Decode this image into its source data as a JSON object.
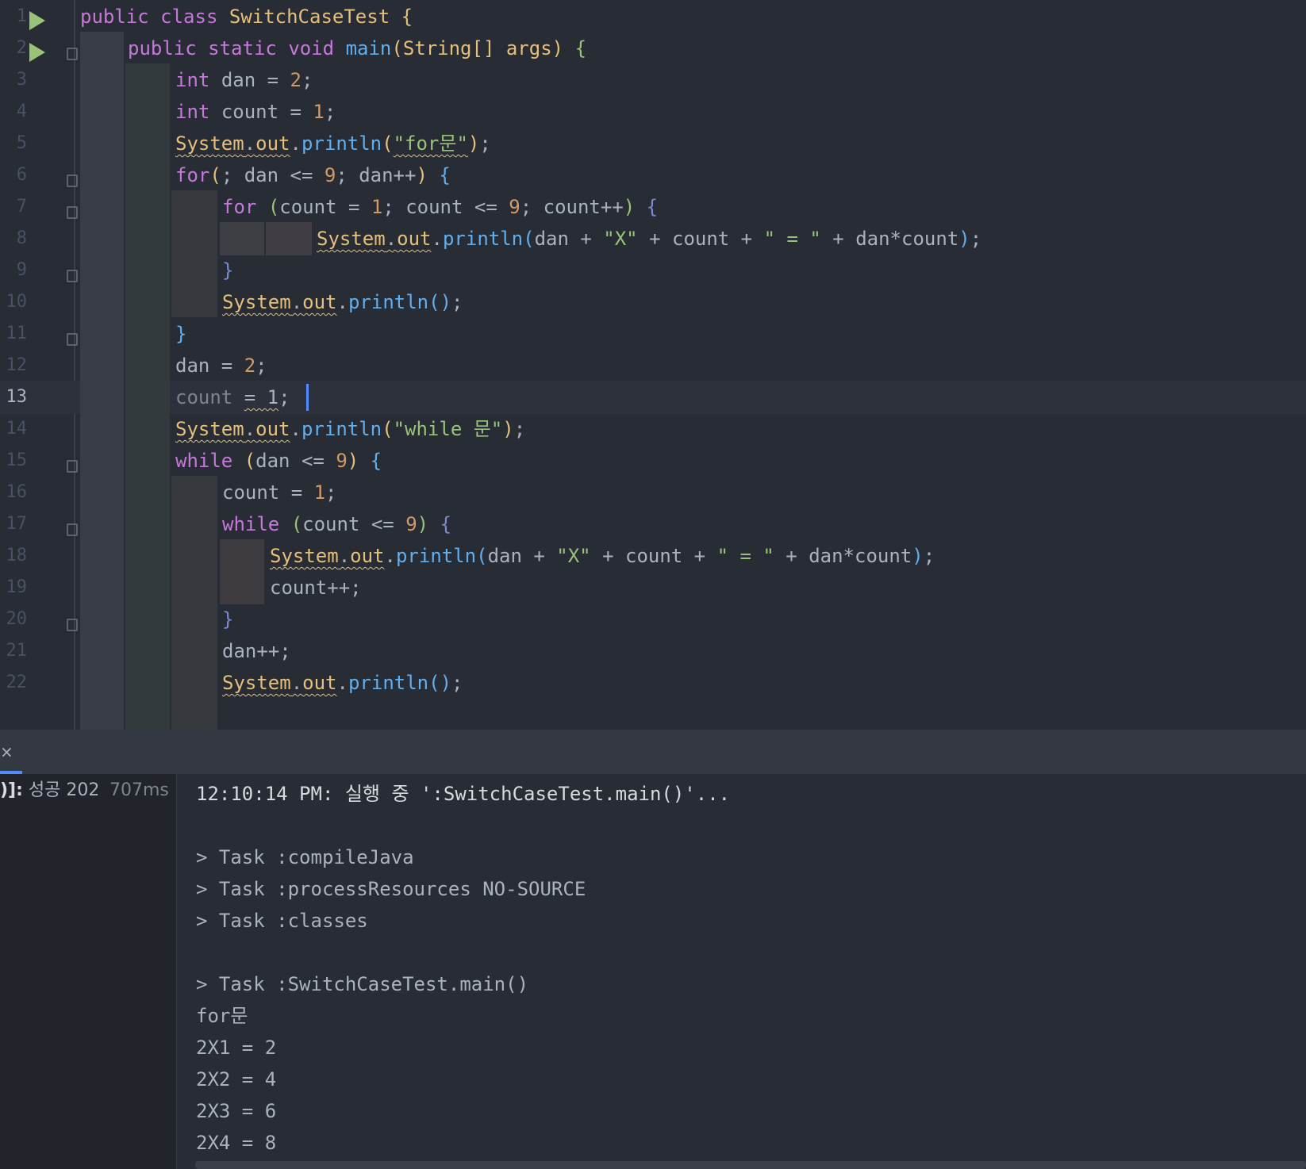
{
  "editor": {
    "current_line": 13,
    "lines": [
      {
        "n": "1"
      },
      {
        "n": "2"
      },
      {
        "n": "3"
      },
      {
        "n": "4"
      },
      {
        "n": "5"
      },
      {
        "n": "6"
      },
      {
        "n": "7"
      },
      {
        "n": "8"
      },
      {
        "n": "9"
      },
      {
        "n": "10"
      },
      {
        "n": "11"
      },
      {
        "n": "12"
      },
      {
        "n": "13"
      },
      {
        "n": "14"
      },
      {
        "n": "15"
      },
      {
        "n": "16"
      },
      {
        "n": "17"
      },
      {
        "n": "18"
      },
      {
        "n": "19"
      },
      {
        "n": "20"
      },
      {
        "n": "21"
      },
      {
        "n": "22"
      }
    ],
    "tokens": {
      "l1": [
        "public",
        "class",
        "SwitchCaseTest",
        "{"
      ],
      "l2": [
        "public",
        "static",
        "void",
        "main",
        "(",
        "String[]",
        "args",
        ")",
        "{"
      ],
      "l3": [
        "int",
        "dan",
        "=",
        "2",
        ";"
      ],
      "l4": [
        "int",
        "count",
        "=",
        "1",
        ";"
      ],
      "l5": [
        "System",
        ".",
        "out",
        ".",
        "println",
        "(",
        "\"for문\"",
        ")",
        ";"
      ],
      "l6": [
        "for",
        "(",
        "; dan <= ",
        "9",
        "; dan++",
        ")",
        "{"
      ],
      "l7": [
        "for",
        "(",
        "count = ",
        "1",
        "; count <= ",
        "9",
        "; count++",
        ")",
        "{"
      ],
      "l8": [
        "System",
        ".",
        "out",
        ".",
        "println",
        "(",
        "dan + ",
        "\"X\"",
        " + count + ",
        "\" = \"",
        " + dan*count",
        ")",
        ";"
      ],
      "l9": [
        "}"
      ],
      "l10": [
        "System",
        ".",
        "out",
        ".",
        "println",
        "()",
        ";"
      ],
      "l11": [
        "}"
      ],
      "l12": [
        "dan = ",
        "2",
        ";"
      ],
      "l13": [
        "count",
        " ",
        "= 1",
        ";"
      ],
      "l14": [
        "System",
        ".",
        "out",
        ".",
        "println",
        "(",
        "\"while 문\"",
        ")",
        ";"
      ],
      "l15": [
        "while",
        "(",
        "dan <= ",
        "9",
        ")",
        "{"
      ],
      "l16": [
        "count = ",
        "1",
        ";"
      ],
      "l17": [
        "while",
        "(",
        "count <= ",
        "9",
        ")",
        "{"
      ],
      "l18": [
        "System",
        ".",
        "out",
        ".",
        "println",
        "(",
        "dan + ",
        "\"X\"",
        " + count + ",
        "\" = \"",
        " + dan*count",
        ")",
        ";"
      ],
      "l19": [
        "count++;"
      ],
      "l20": [
        "}"
      ],
      "l21": [
        "dan++;"
      ],
      "l22": [
        "System",
        ".",
        "out",
        ".",
        "println",
        "()",
        ";"
      ]
    }
  },
  "build": {
    "status_prefix": ")]:",
    "status_text": "성공 202",
    "time": "707ms"
  },
  "console": {
    "lines": [
      "12:10:14 PM: 실행 중 ':SwitchCaseTest.main()'...",
      "",
      "> Task :compileJava",
      "> Task :processResources NO-SOURCE",
      "> Task :classes",
      "",
      "> Task :SwitchCaseTest.main()",
      "for문",
      "2X1 = 2",
      "2X2 = 4",
      "2X3 = 6",
      "2X4 = 8"
    ]
  },
  "colors": {
    "background": "#282c34",
    "keyword": "#c678dd",
    "class": "#e5c07b",
    "function": "#61afef",
    "number": "#d19a66",
    "string": "#98c379",
    "accent": "#528bff"
  },
  "icons": {
    "run": "run-gutter-icon",
    "fold": "fold-marker-icon",
    "close": "close-icon"
  }
}
